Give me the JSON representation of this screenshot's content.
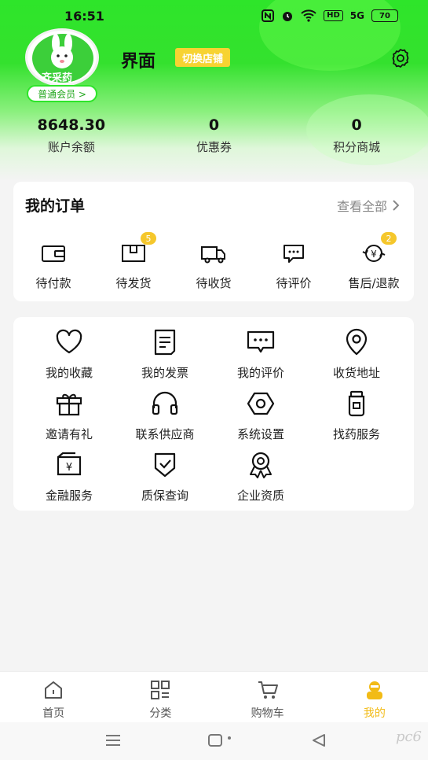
{
  "status_bar": {
    "time": "16:51",
    "hd_label": "HD",
    "signal_label": "5G",
    "battery_level": "70"
  },
  "profile": {
    "avatar_brand": "齐采药",
    "member_level": "普通会员 >",
    "shop_name": "界面",
    "switch_shop_label": "切换店铺"
  },
  "stats": [
    {
      "value": "8648.30",
      "label": "账户余额"
    },
    {
      "value": "0",
      "label": "优惠券"
    },
    {
      "value": "0",
      "label": "积分商城"
    }
  ],
  "orders": {
    "title": "我的订单",
    "view_all": "查看全部",
    "items": [
      {
        "label": "待付款",
        "icon": "wallet-icon",
        "badge": null
      },
      {
        "label": "待发货",
        "icon": "package-icon",
        "badge": "5"
      },
      {
        "label": "待收货",
        "icon": "truck-icon",
        "badge": null
      },
      {
        "label": "待评价",
        "icon": "comment-icon",
        "badge": null
      },
      {
        "label": "售后/退款",
        "icon": "refund-icon",
        "badge": "2"
      }
    ]
  },
  "tools": [
    {
      "label": "我的收藏",
      "icon": "heart-icon"
    },
    {
      "label": "我的发票",
      "icon": "invoice-icon"
    },
    {
      "label": "我的评价",
      "icon": "review-icon"
    },
    {
      "label": "收货地址",
      "icon": "location-icon"
    },
    {
      "label": "邀请有礼",
      "icon": "gift-icon"
    },
    {
      "label": "联系供应商",
      "icon": "headset-icon"
    },
    {
      "label": "系统设置",
      "icon": "settings-icon"
    },
    {
      "label": "找药服务",
      "icon": "medicine-icon"
    },
    {
      "label": "金融服务",
      "icon": "finance-icon"
    },
    {
      "label": "质保查询",
      "icon": "shield-icon"
    },
    {
      "label": "企业资质",
      "icon": "award-icon"
    }
  ],
  "bottom_nav": [
    {
      "label": "首页",
      "icon": "home-icon"
    },
    {
      "label": "分类",
      "icon": "category-icon"
    },
    {
      "label": "购物车",
      "icon": "cart-icon"
    },
    {
      "label": "我的",
      "icon": "profile-icon",
      "active": true
    }
  ],
  "watermark": "pc6",
  "colors": {
    "brand_green": "#2ee52a",
    "accent_yellow": "#f7d332",
    "badge_yellow": "#f5c72c",
    "active_nav": "#f2bb16"
  }
}
